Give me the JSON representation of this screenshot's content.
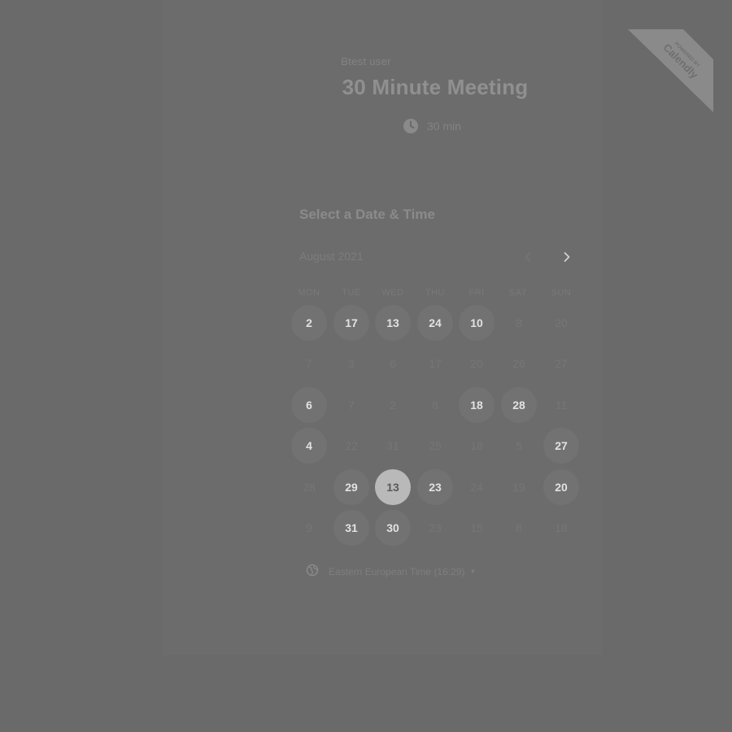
{
  "header": {
    "host_name": "Btest user",
    "event_title": "30 Minute Meeting",
    "duration": "30 min",
    "badge_powered": "POWERED BY",
    "badge_brand": "Calendly"
  },
  "scheduler": {
    "section_title": "Select a Date & Time",
    "month_label": "August 2021",
    "weekdays": [
      "MON",
      "TUE",
      "WED",
      "THU",
      "FRI",
      "SAT",
      "SUN"
    ],
    "weeks": [
      [
        {
          "d": "2",
          "s": "available"
        },
        {
          "d": "17",
          "s": "available"
        },
        {
          "d": "13",
          "s": "available"
        },
        {
          "d": "24",
          "s": "available"
        },
        {
          "d": "10",
          "s": "available"
        },
        {
          "d": "8",
          "s": "unavailable"
        },
        {
          "d": "20",
          "s": "unavailable"
        }
      ],
      [
        {
          "d": "7",
          "s": "unavailable"
        },
        {
          "d": "3",
          "s": "unavailable"
        },
        {
          "d": "6",
          "s": "unavailable"
        },
        {
          "d": "17",
          "s": "unavailable"
        },
        {
          "d": "20",
          "s": "unavailable"
        },
        {
          "d": "26",
          "s": "unavailable"
        },
        {
          "d": "27",
          "s": "unavailable"
        }
      ],
      [
        {
          "d": "6",
          "s": "available"
        },
        {
          "d": "7",
          "s": "unavailable"
        },
        {
          "d": "2",
          "s": "unavailable"
        },
        {
          "d": "8",
          "s": "unavailable"
        },
        {
          "d": "18",
          "s": "available"
        },
        {
          "d": "28",
          "s": "available"
        },
        {
          "d": "11",
          "s": "unavailable"
        }
      ],
      [
        {
          "d": "4",
          "s": "available"
        },
        {
          "d": "22",
          "s": "unavailable"
        },
        {
          "d": "31",
          "s": "unavailable"
        },
        {
          "d": "25",
          "s": "unavailable"
        },
        {
          "d": "18",
          "s": "unavailable"
        },
        {
          "d": "5",
          "s": "unavailable"
        },
        {
          "d": "27",
          "s": "available"
        }
      ],
      [
        {
          "d": "28",
          "s": "unavailable"
        },
        {
          "d": "29",
          "s": "available"
        },
        {
          "d": "13",
          "s": "selected"
        },
        {
          "d": "23",
          "s": "available"
        },
        {
          "d": "24",
          "s": "unavailable"
        },
        {
          "d": "19",
          "s": "unavailable"
        },
        {
          "d": "20",
          "s": "available"
        }
      ],
      [
        {
          "d": "9",
          "s": "unavailable"
        },
        {
          "d": "31",
          "s": "available"
        },
        {
          "d": "30",
          "s": "available"
        },
        {
          "d": "23",
          "s": "unavailable"
        },
        {
          "d": "15",
          "s": "unavailable"
        },
        {
          "d": "8",
          "s": "unavailable"
        },
        {
          "d": "18",
          "s": "unavailable"
        }
      ]
    ],
    "timezone_label": "Eastern European Time (16:29)"
  },
  "icons": {
    "duration": "clock-icon",
    "prev": "chevron-left-icon",
    "next": "chevron-right-icon",
    "timezone": "globe-icon",
    "caret": "caret-down-icon"
  },
  "colors": {
    "page_bg": "#6a6a6a",
    "available_bg": "#727272",
    "selected_bg": "#b9b9b9"
  }
}
